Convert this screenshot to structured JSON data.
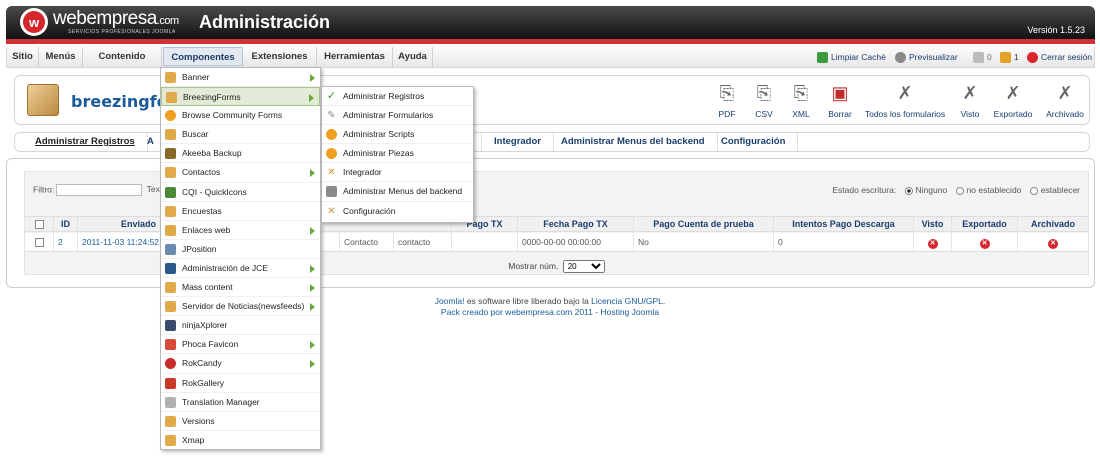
{
  "header": {
    "brand": "webempresa",
    "brand_suffix": ".com",
    "tagline": "SERVICIOS PROFESIONALES JOOMLA",
    "title": "Administración",
    "version": "Versión 1.5.23"
  },
  "menubar": {
    "items": [
      "Sitio",
      "Menús",
      "Contenido",
      "Componentes",
      "Extensiones",
      "Herramientas",
      "Ayuda"
    ],
    "right": {
      "limpiar": "Limpiar Caché",
      "previsualizar": "Previsualizar",
      "msg_count": "0",
      "users_count": "1",
      "cerrar": "Cerrar sesión"
    }
  },
  "toolbar": {
    "component": "breezingfor",
    "buttons": [
      "PDF",
      "CSV",
      "XML",
      "Borrar",
      "Todos los formularios",
      "Visto",
      "Exportado",
      "Archivado"
    ]
  },
  "tabs": [
    "Administrar Registros",
    "A",
    "Integrador",
    "Administrar Menus del backend",
    "Configuración"
  ],
  "filter": {
    "label": "Filtro:",
    "text_label": "Text",
    "estado_label": "Estado escritura:",
    "options": [
      "Ninguno",
      "no establecido",
      "establecer"
    ]
  },
  "table": {
    "headers": [
      "ID",
      "Enviado",
      "Pago TX",
      "Fecha Pago TX",
      "Pago Cuenta de prueba",
      "Intentos Pago Descarga",
      "Visto",
      "Exportado",
      "Archivado"
    ],
    "row": {
      "id": "2",
      "enviado": "2011-11-03 11:24:52",
      "col_a": "Contacto",
      "col_b": "contacto",
      "fecha_pago": "0000-00-00 00:00:00",
      "prueba": "No",
      "intentos": "0"
    },
    "pager_label": "Mostrar núm.",
    "pager_value": "20"
  },
  "footer": {
    "line1_link1": "Joomla!",
    "line1_text": " es software libre liberado bajo la ",
    "line1_link2": "Licencia GNU/GPL",
    "line1_end": ".",
    "line2_a": "Pack creado por webempresa.com 2011 - ",
    "line2_link": "Hosting Joomla"
  },
  "components_menu": [
    "Banner",
    "BreezingForms",
    "Browse Community Forms",
    "Buscar",
    "Akeeba Backup",
    "Contactos",
    "CQI - QuickIcons",
    "Encuestas",
    "Enlaces web",
    "JPosition",
    "Administración de JCE",
    "Mass content",
    "Servidor de Noticias(newsfeeds)",
    "ninjaXplorer",
    "Phoca Favicon",
    "RokCandy",
    "RokGallery",
    "Translation Manager",
    "Versions",
    "Xmap"
  ],
  "breezing_submenu": [
    "Administrar Registros",
    "Administrar Formularios",
    "Administrar Scripts",
    "Administrar Piezas",
    "Integrador",
    "Administrar Menus del backend",
    "Configuración"
  ],
  "colors": {
    "header_red": "#cf3237",
    "link_blue": "#1a3d6d",
    "submenu_arrow": "#6aa83a"
  }
}
